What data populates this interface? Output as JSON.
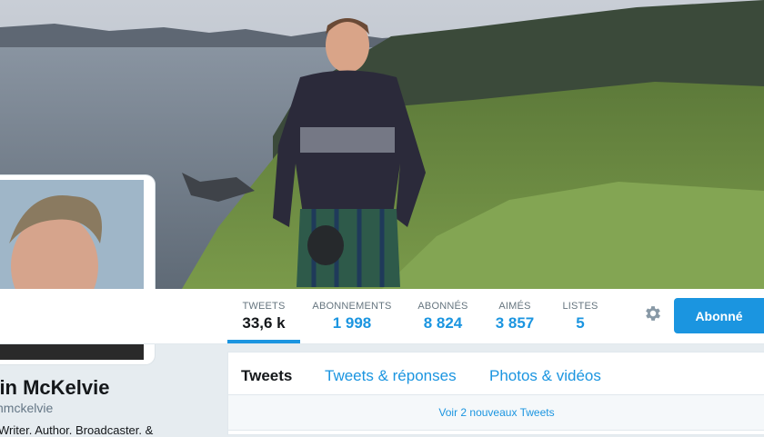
{
  "profile": {
    "name": "bin McKelvie",
    "handle": "nmckelvie",
    "bio": "Writer. Author. Broadcaster. &"
  },
  "stats": [
    {
      "label": "TWEETS",
      "value": "33,6 k"
    },
    {
      "label": "ABONNEMENTS",
      "value": "1 998"
    },
    {
      "label": "ABONNÉS",
      "value": "8 824"
    },
    {
      "label": "AIMÉS",
      "value": "3 857"
    },
    {
      "label": "LISTES",
      "value": "5"
    }
  ],
  "actions": {
    "follow_label": "Abonné",
    "settings_icon": "gear-icon"
  },
  "timeline": {
    "tabs": [
      "Tweets",
      "Tweets & réponses",
      "Photos & vidéos"
    ],
    "new_tweets": "Voir 2 nouveaux Tweets"
  },
  "colors": {
    "accent": "#1b95e0",
    "background": "#e6ecf0",
    "text": "#14171a",
    "muted": "#66757f"
  }
}
